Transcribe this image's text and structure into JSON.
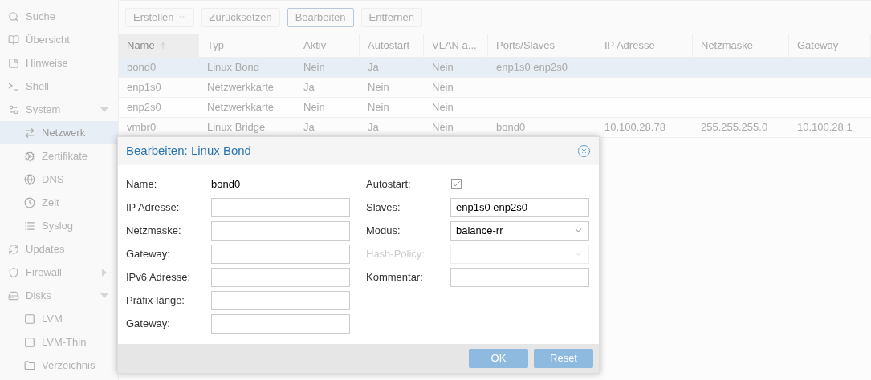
{
  "sidebar": {
    "items": [
      {
        "label": "Suche",
        "selected": false
      },
      {
        "label": "Übersicht",
        "selected": false
      },
      {
        "label": "Hinweise",
        "selected": false
      },
      {
        "label": "Shell",
        "selected": false
      },
      {
        "label": "System",
        "selected": false,
        "expanded": true,
        "children": [
          {
            "label": "Netzwerk",
            "selected": true
          },
          {
            "label": "Zertifikate",
            "selected": false
          },
          {
            "label": "DNS",
            "selected": false
          },
          {
            "label": "Zeit",
            "selected": false
          },
          {
            "label": "Syslog",
            "selected": false
          }
        ]
      },
      {
        "label": "Updates",
        "selected": false
      },
      {
        "label": "Firewall",
        "selected": false,
        "expanded": false
      },
      {
        "label": "Disks",
        "selected": false,
        "expanded": true,
        "children": [
          {
            "label": "LVM",
            "selected": false
          },
          {
            "label": "LVM-Thin",
            "selected": false
          },
          {
            "label": "Verzeichnis",
            "selected": false
          }
        ]
      }
    ]
  },
  "toolbar": [
    {
      "label": "Erstellen",
      "kind": "menu",
      "focused": false
    },
    {
      "label": "Zurücksetzen",
      "kind": "button",
      "focused": false
    },
    {
      "label": "Bearbeiten",
      "kind": "button",
      "focused": true
    },
    {
      "label": "Entfernen",
      "kind": "button",
      "focused": false
    }
  ],
  "table": {
    "columns": [
      {
        "label": "Name",
        "sorted": true
      },
      {
        "label": "Typ",
        "sorted": false
      },
      {
        "label": "Aktiv",
        "sorted": false
      },
      {
        "label": "Autostart",
        "sorted": false
      },
      {
        "label": "VLAN a...",
        "sorted": false
      },
      {
        "label": "Ports/Slaves",
        "sorted": false
      },
      {
        "label": "IP Adresse",
        "sorted": false
      },
      {
        "label": "Netzmaske",
        "sorted": false
      },
      {
        "label": "Gateway",
        "sorted": false
      }
    ],
    "rows": [
      {
        "selected": true,
        "cells": [
          "bond0",
          "Linux Bond",
          "Nein",
          "Ja",
          "Nein",
          "enp1s0 enp2s0",
          "",
          "",
          ""
        ]
      },
      {
        "selected": false,
        "cells": [
          "enp1s0",
          "Netzwerkkarte",
          "Ja",
          "Nein",
          "Nein",
          "",
          "",
          "",
          ""
        ]
      },
      {
        "selected": false,
        "cells": [
          "enp2s0",
          "Netzwerkkarte",
          "Nein",
          "Nein",
          "Nein",
          "",
          "",
          "",
          ""
        ]
      },
      {
        "selected": false,
        "cells": [
          "vmbr0",
          "Linux Bridge",
          "Ja",
          "Ja",
          "Nein",
          "bond0",
          "10.100.28.78",
          "255.255.255.0",
          "10.100.28.1"
        ]
      }
    ]
  },
  "dialog": {
    "title": "Bearbeiten: Linux Bond",
    "left_fields": [
      {
        "label": "Name:",
        "kind": "static",
        "value": "bond0"
      },
      {
        "label": "IP Adresse:",
        "kind": "input"
      },
      {
        "label": "Netzmaske:",
        "kind": "input"
      },
      {
        "label": "Gateway:",
        "kind": "input"
      },
      {
        "label": "IPv6 Adresse:",
        "kind": "input"
      },
      {
        "label": "Präfix-länge:",
        "kind": "input"
      },
      {
        "label": "Gateway:",
        "kind": "input"
      }
    ],
    "right_fields": [
      {
        "label": "Autostart:",
        "kind": "checkbox",
        "checked": true
      },
      {
        "label": "Slaves:",
        "kind": "input",
        "value": "enp1s0 enp2s0"
      },
      {
        "label": "Modus:",
        "kind": "select",
        "value": "balance-rr",
        "disabled": false
      },
      {
        "label": "Hash-Policy:",
        "kind": "select",
        "disabled": true
      },
      {
        "label": "Kommentar:",
        "kind": "input"
      }
    ],
    "buttons": [
      {
        "label": "OK"
      },
      {
        "label": "Reset"
      }
    ]
  }
}
